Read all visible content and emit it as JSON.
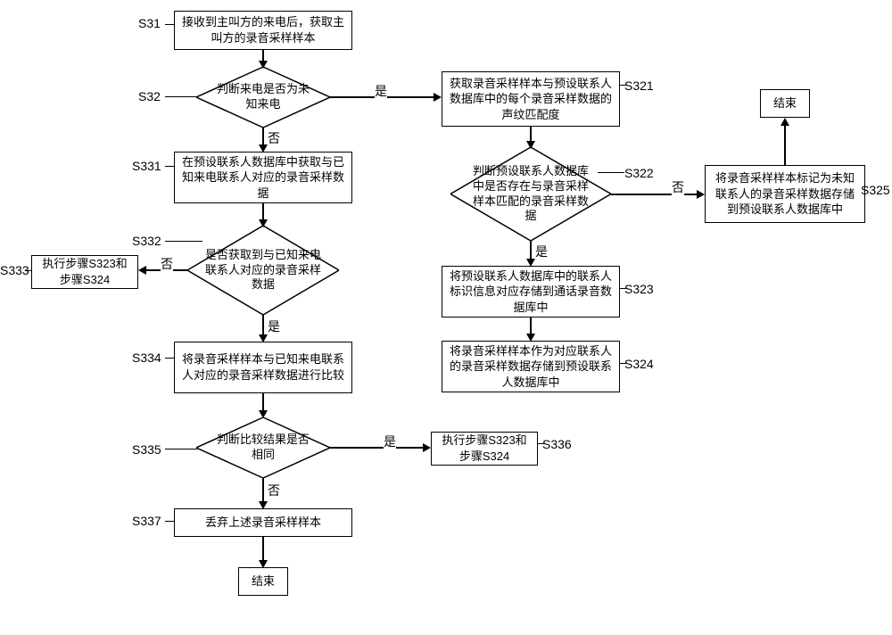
{
  "labels": {
    "s31": "S31",
    "s32": "S32",
    "s321": "S321",
    "s322": "S322",
    "s323": "S323",
    "s324": "S324",
    "s325": "S325",
    "s331": "S331",
    "s332": "S332",
    "s333": "S333",
    "s334": "S334",
    "s335": "S335",
    "s336": "S336",
    "s337": "S337"
  },
  "edges": {
    "yes": "是",
    "no": "否"
  },
  "nodes": {
    "n31": "接收到主叫方的来电后，获取主叫方的录音采样样本",
    "n32": "判断来电是否为未知来电",
    "n321": "获取录音采样样本与预设联系人数据库中的每个录音采样数据的声纹匹配度",
    "n322": "判断预设联系人数据库中是否存在与录音采样样本匹配的录音采样数据",
    "n323": "将预设联系人数据库中的联系人标识信息对应存储到通话录音数据库中",
    "n324": "将录音采样样本作为对应联系人的录音采样数据存储到预设联系人数据库中",
    "n325": "将录音采样样本标记为未知联系人的录音采样数据存储到预设联系人数据库中",
    "n331": "在预设联系人数据库中获取与已知来电联系人对应的录音采样数据",
    "n332": "是否获取到与已知来电联系人对应的录音采样数据",
    "n333": "执行步骤S323和步骤S324",
    "n334": "将录音采样样本与已知来电联系人对应的录音采样数据进行比较",
    "n335": "判断比较结果是否相同",
    "n336": "执行步骤S323和步骤S324",
    "n337": "丢弃上述录音采样样本",
    "end1": "结束",
    "end2": "结束"
  }
}
